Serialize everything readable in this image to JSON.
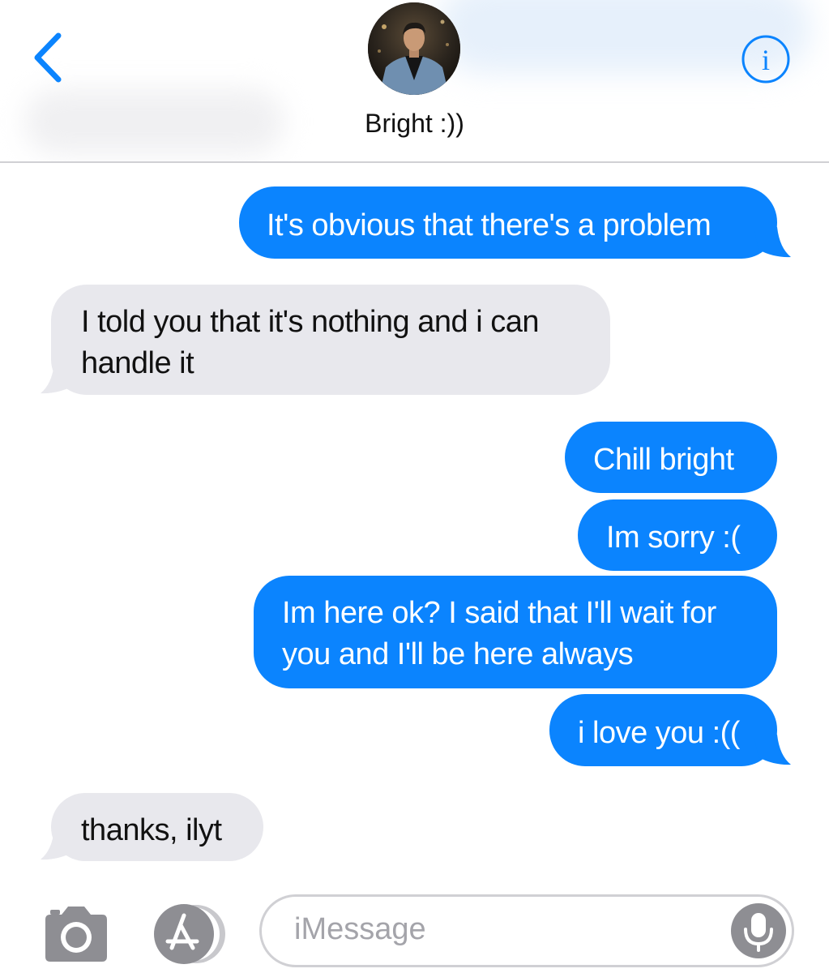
{
  "header": {
    "contact_name": "Bright :))",
    "back_icon": "chevron-left-icon",
    "info_icon": "info-icon",
    "accent_color": "#0b84fe"
  },
  "messages": [
    {
      "direction": "sent",
      "text": "It's obvious that there's a problem",
      "tail": true
    },
    {
      "direction": "received",
      "lines": [
        "I told you that it's nothing and i can",
        "handle it"
      ],
      "tail": true
    },
    {
      "direction": "sent",
      "text": "Chill bright",
      "tail": false
    },
    {
      "direction": "sent",
      "text": "Im sorry :(",
      "tail": false
    },
    {
      "direction": "sent",
      "lines": [
        "Im here ok? I said that I'll wait for",
        "you and I'll be here always"
      ],
      "tail": false
    },
    {
      "direction": "sent",
      "text": "i love you :((",
      "tail": true
    },
    {
      "direction": "received",
      "text": "thanks, ilyt",
      "tail": true
    }
  ],
  "colors": {
    "sent_bubble": "#0b84fe",
    "received_bubble": "#e8e8ed",
    "sent_text": "#ffffff",
    "received_text": "#111111"
  },
  "input_bar": {
    "camera_icon": "camera-icon",
    "apps_icon": "app-store-icon",
    "placeholder": "iMessage",
    "mic_icon": "microphone-icon"
  }
}
